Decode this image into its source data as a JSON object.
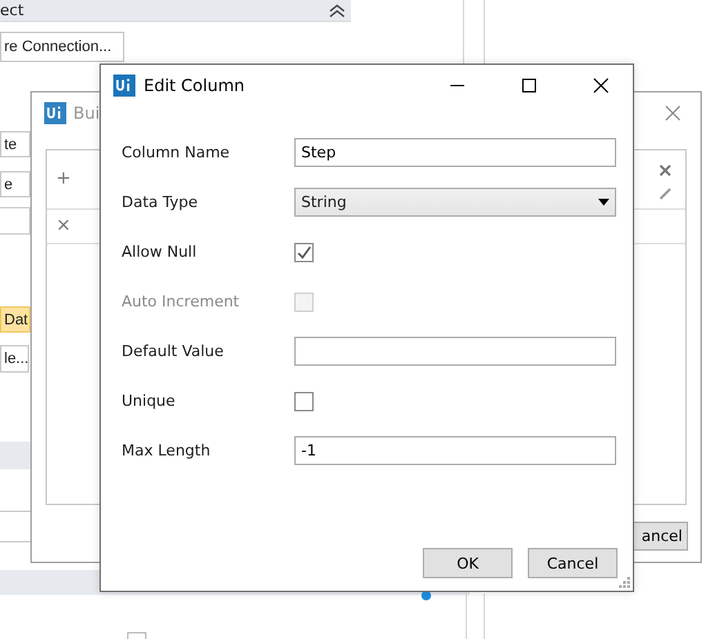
{
  "background_panel": {
    "header": "ect",
    "buttons": [
      {
        "label": "re Connection..."
      },
      {
        "label": "te"
      },
      {
        "label": "e"
      },
      {
        "label": "Dat"
      },
      {
        "label": "le..."
      }
    ],
    "checkbox": {
      "checked": false
    }
  },
  "back_window": {
    "title": "Bui",
    "table_buttons": [
      "+",
      "×"
    ],
    "cancel_button": "ancel"
  },
  "dialog": {
    "title": "Edit Column",
    "fields": [
      {
        "kind": "text",
        "label": "Column Name",
        "value": "Step"
      },
      {
        "kind": "select",
        "label": "Data Type",
        "value": "String"
      },
      {
        "kind": "checkbox",
        "label": "Allow Null",
        "checked": true,
        "disabled": false
      },
      {
        "kind": "checkbox",
        "label": "Auto Increment",
        "checked": false,
        "disabled": true
      },
      {
        "kind": "text",
        "label": "Default Value"
      },
      {
        "kind": "checkbox",
        "label": "Unique",
        "checked": false,
        "disabled": false
      },
      {
        "kind": "text",
        "label": "Max Length",
        "value": "-1"
      }
    ],
    "buttons": [
      "OK",
      "Cancel"
    ]
  }
}
